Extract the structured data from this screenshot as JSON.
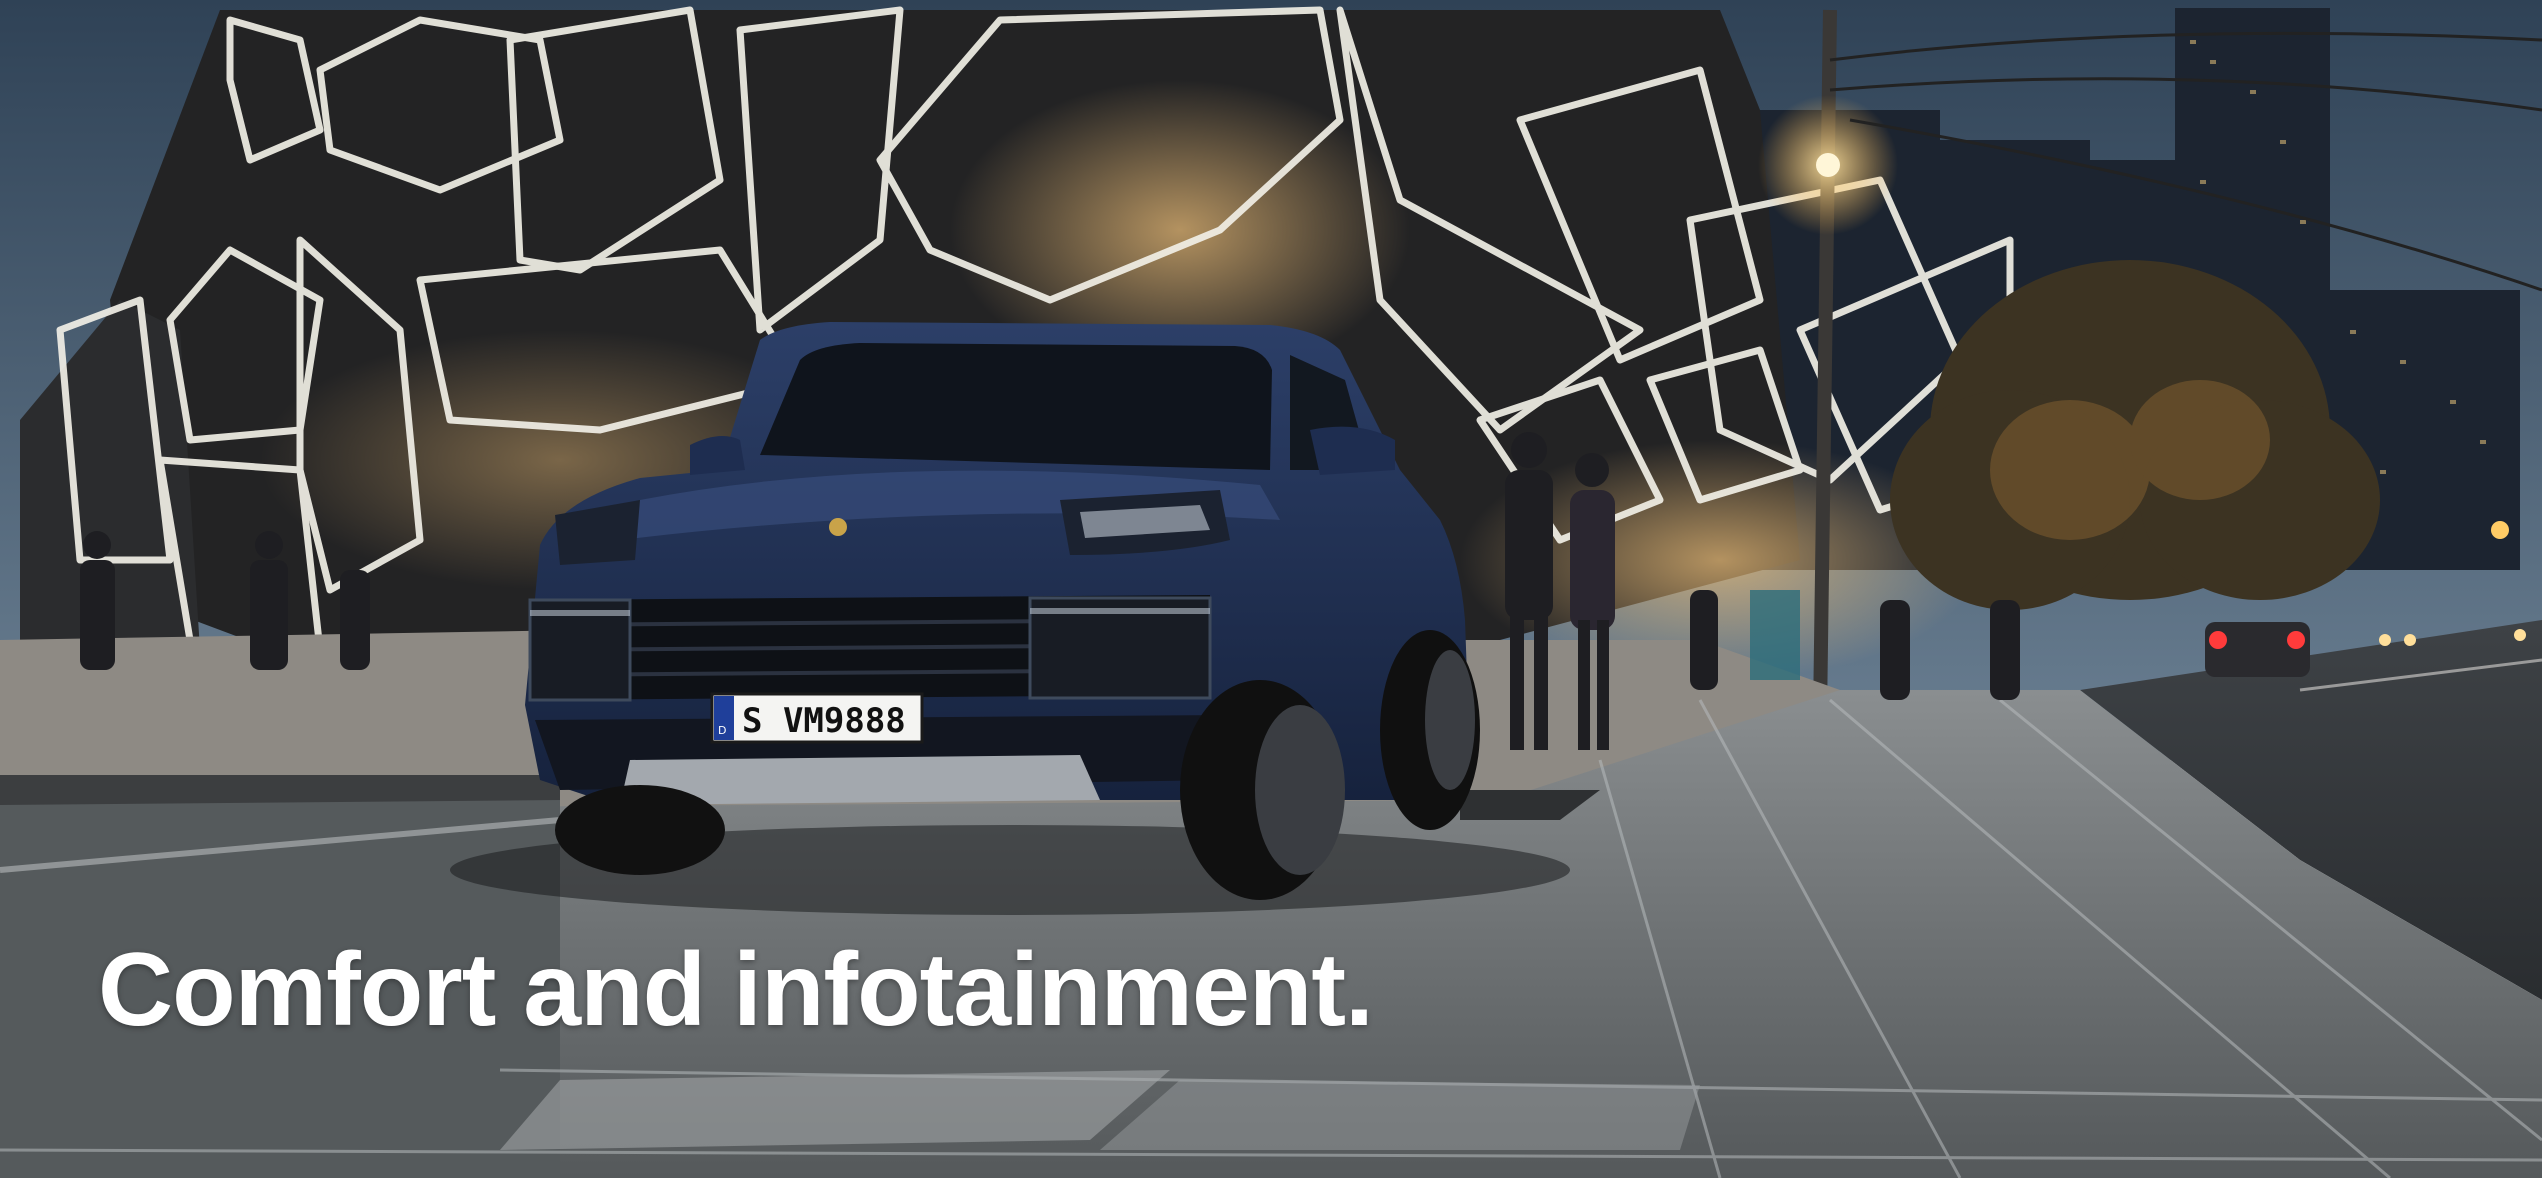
{
  "hero": {
    "headline": "Comfort and infotainment.",
    "license_plate": "S VM9888",
    "plate_country": "D"
  },
  "colors": {
    "sky_top": "#2f4256",
    "sky_bottom": "#6a7f92",
    "car_body": "#1d2d4f",
    "pavement": "#7c8083",
    "street_light": "#ffd88a",
    "headline": "#ffffff"
  }
}
